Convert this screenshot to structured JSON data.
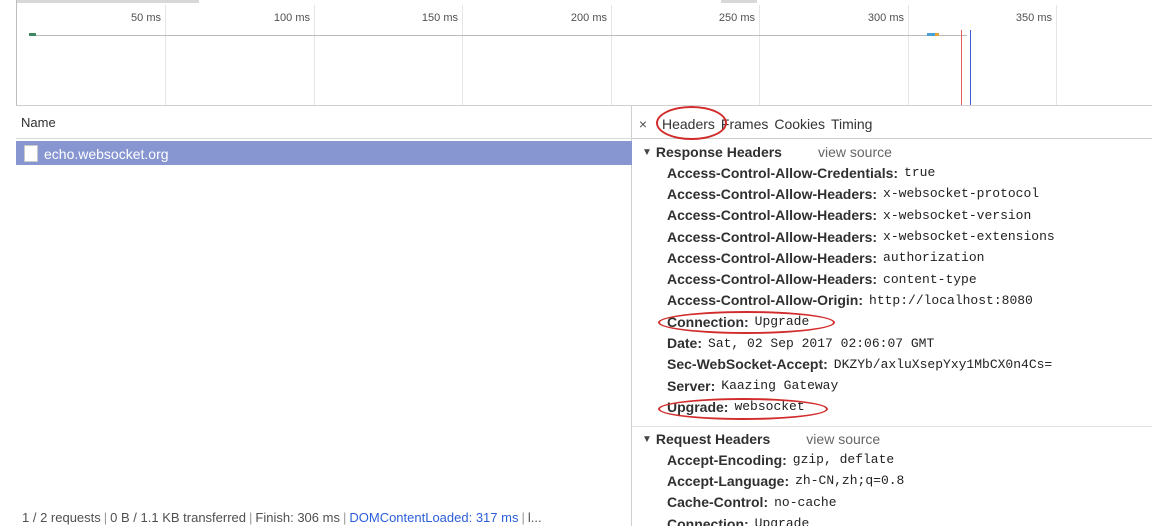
{
  "timeline": {
    "ticks": [
      "50 ms",
      "100 ms",
      "150 ms",
      "200 ms",
      "250 ms",
      "300 ms",
      "350 ms"
    ]
  },
  "request_list": {
    "column_header": "Name",
    "rows": [
      {
        "name": "echo.websocket.org",
        "icon": "document-icon",
        "selected": true
      }
    ]
  },
  "status_bar": {
    "requests": "1 / 2 requests",
    "transferred": "0 B / 1.1 KB transferred",
    "finish": "Finish: 306 ms",
    "dom_content_loaded": "DOMContentLoaded: 317 ms",
    "overflow": "l..."
  },
  "details": {
    "close_glyph": "×",
    "tabs": [
      "Headers",
      "Frames",
      "Cookies",
      "Timing"
    ],
    "active_tab": "Headers",
    "response_headers": {
      "title": "Response Headers",
      "view_source": "view source",
      "items": [
        {
          "key": "Access-Control-Allow-Credentials:",
          "value": "true"
        },
        {
          "key": "Access-Control-Allow-Headers:",
          "value": "x-websocket-protocol"
        },
        {
          "key": "Access-Control-Allow-Headers:",
          "value": "x-websocket-version"
        },
        {
          "key": "Access-Control-Allow-Headers:",
          "value": "x-websocket-extensions"
        },
        {
          "key": "Access-Control-Allow-Headers:",
          "value": "authorization"
        },
        {
          "key": "Access-Control-Allow-Headers:",
          "value": "content-type"
        },
        {
          "key": "Access-Control-Allow-Origin:",
          "value": "http://localhost:8080"
        },
        {
          "key": "Connection:",
          "value": "Upgrade"
        },
        {
          "key": "Date:",
          "value": "Sat, 02 Sep 2017 02:06:07 GMT"
        },
        {
          "key": "Sec-WebSocket-Accept:",
          "value": "DKZYb/axluXsepYxy1MbCX0n4Cs="
        },
        {
          "key": "Server:",
          "value": "Kaazing Gateway"
        },
        {
          "key": "Upgrade:",
          "value": "websocket"
        }
      ]
    },
    "request_headers": {
      "title": "Request Headers",
      "view_source": "view source",
      "items": [
        {
          "key": "Accept-Encoding:",
          "value": "gzip, deflate"
        },
        {
          "key": "Accept-Language:",
          "value": "zh-CN,zh;q=0.8"
        },
        {
          "key": "Cache-Control:",
          "value": "no-cache"
        },
        {
          "key": "Connection:",
          "value": "Upgrade"
        }
      ]
    }
  },
  "colors": {
    "selected_row": "#8796d1",
    "annotation_ring": "#d22b2b",
    "load_line": "#e25b5b",
    "dom_content_loaded_line": "#3e58d6",
    "link_blue": "#2b5fd9"
  }
}
